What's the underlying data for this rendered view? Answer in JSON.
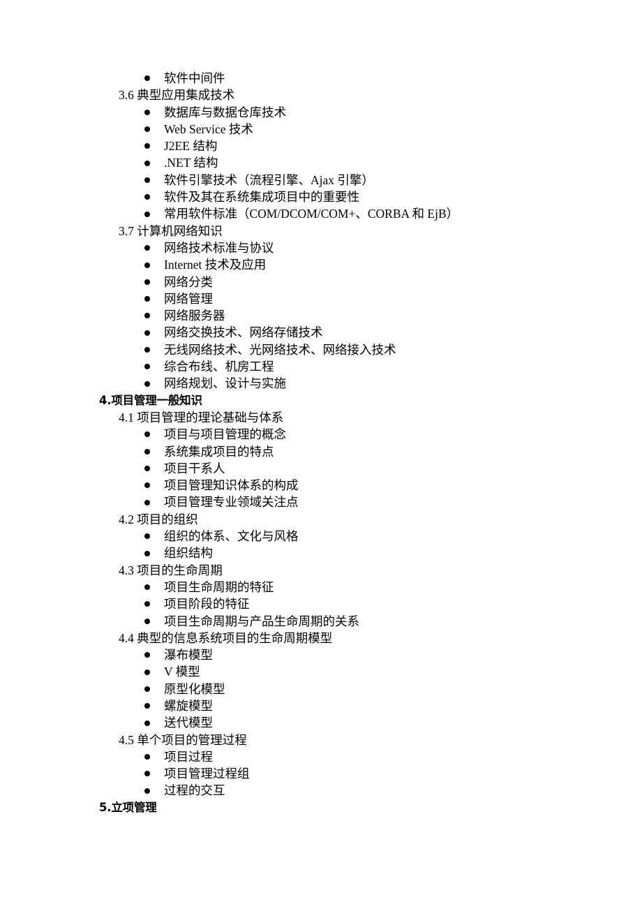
{
  "document": {
    "page_background": "#ffffff",
    "text_color": "#000000"
  },
  "blocks": [
    {
      "type": "bullet",
      "text": "软件中间件"
    },
    {
      "type": "section",
      "text": "3.6 典型应用集成技术"
    },
    {
      "type": "bullet",
      "text": "数据库与数据仓库技术"
    },
    {
      "type": "bullet",
      "text": "Web Service 技术"
    },
    {
      "type": "bullet",
      "text": "J2EE 结构"
    },
    {
      "type": "bullet",
      "text": ".NET 结构"
    },
    {
      "type": "bullet",
      "text": "软件引擎技术（流程引擎、Ajax 引擎）"
    },
    {
      "type": "bullet",
      "text": "软件及其在系统集成项目中的重要性"
    },
    {
      "type": "bullet",
      "text": "常用软件标准（COM/DCOM/COM+、CORBA 和 EjB）"
    },
    {
      "type": "section",
      "text": "3.7 计算机网络知识"
    },
    {
      "type": "bullet",
      "text": "网络技术标准与协议"
    },
    {
      "type": "bullet",
      "text": "Internet 技术及应用"
    },
    {
      "type": "bullet",
      "text": "网络分类"
    },
    {
      "type": "bullet",
      "text": "网络管理"
    },
    {
      "type": "bullet",
      "text": "网络服务器"
    },
    {
      "type": "bullet",
      "text": "网络交换技术、网络存储技术"
    },
    {
      "type": "bullet",
      "text": "无线网络技术、光网络技术、网络接入技术"
    },
    {
      "type": "bullet",
      "text": "综合布线、机房工程"
    },
    {
      "type": "bullet",
      "text": "网络规划、设计与实施"
    },
    {
      "type": "heading",
      "text": "4.项目管理一般知识"
    },
    {
      "type": "section",
      "text": "4.1 项目管理的理论基础与体系"
    },
    {
      "type": "bullet",
      "text": "项目与项目管理的概念"
    },
    {
      "type": "bullet",
      "text": "系统集成项目的特点"
    },
    {
      "type": "bullet",
      "text": "项目干系人"
    },
    {
      "type": "bullet",
      "text": "项目管理知识体系的构成"
    },
    {
      "type": "bullet",
      "text": "项目管理专业领域关注点"
    },
    {
      "type": "section",
      "text": "4.2 项目的组织"
    },
    {
      "type": "bullet",
      "text": "组织的体系、文化与风格"
    },
    {
      "type": "bullet",
      "text": "组织结构"
    },
    {
      "type": "section",
      "text": "4.3 项目的生命周期"
    },
    {
      "type": "bullet",
      "text": "项目生命周期的特征"
    },
    {
      "type": "bullet",
      "text": "项目阶段的特征"
    },
    {
      "type": "bullet",
      "text": "项目生命周期与产品生命周期的关系"
    },
    {
      "type": "section",
      "text": "4.4 典型的信息系统项目的生命周期模型"
    },
    {
      "type": "bullet",
      "text": "瀑布模型"
    },
    {
      "type": "bullet",
      "text": "V 模型"
    },
    {
      "type": "bullet",
      "text": "原型化模型"
    },
    {
      "type": "bullet",
      "text": "螺旋模型"
    },
    {
      "type": "bullet",
      "text": "送代模型"
    },
    {
      "type": "section",
      "text": "4.5 单个项目的管理过程"
    },
    {
      "type": "bullet",
      "text": "项目过程"
    },
    {
      "type": "bullet",
      "text": "项目管理过程组"
    },
    {
      "type": "bullet",
      "text": "过程的交互"
    },
    {
      "type": "heading",
      "text": "5.立项管理"
    }
  ]
}
